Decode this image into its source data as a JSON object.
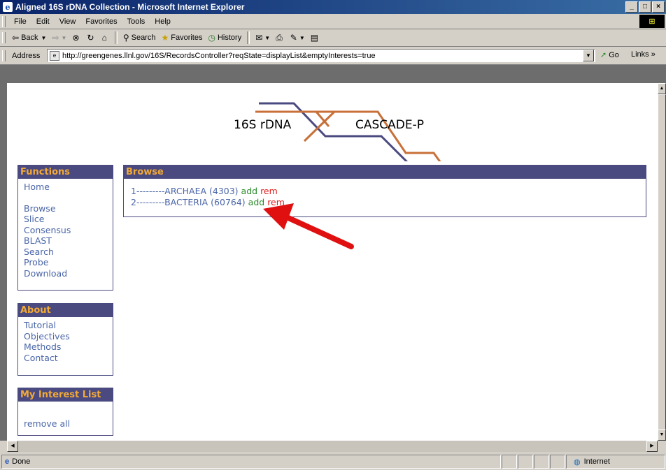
{
  "window": {
    "title": "Aligned 16S rDNA Collection - Microsoft Internet Explorer",
    "min": "_",
    "max": "□",
    "close": "×"
  },
  "menu": [
    "File",
    "Edit",
    "View",
    "Favorites",
    "Tools",
    "Help"
  ],
  "toolbar": {
    "back": "Back",
    "search": "Search",
    "favorites": "Favorites",
    "history": "History"
  },
  "address": {
    "label": "Address",
    "url": "http://greengenes.llnl.gov/16S/RecordsController?reqState=displayList&emptyInterests=true",
    "go": "Go",
    "links": "Links"
  },
  "logo": {
    "left": "16S rDNA",
    "right": "CASCADE-P"
  },
  "functions": {
    "title": "Functions",
    "items": [
      "Home",
      "Browse",
      "Slice",
      "Consensus",
      "BLAST",
      "Search",
      "Probe",
      "Download"
    ]
  },
  "about": {
    "title": "About",
    "items": [
      "Tutorial",
      "Objectives",
      "Methods",
      "Contact"
    ]
  },
  "interest": {
    "title": "My Interest List",
    "remove_all": "remove all"
  },
  "browse": {
    "title": "Browse",
    "rows": [
      {
        "label": "1---------ARCHAEA (4303)",
        "add": "add",
        "rem": "rem"
      },
      {
        "label": "2---------BACTERIA (60764)",
        "add": "add",
        "rem": "rem"
      }
    ]
  },
  "status": {
    "left": "Done",
    "zone": "Internet"
  },
  "colors": {
    "panel_header_bg": "#4a4a80",
    "panel_header_text": "#f3a935",
    "link": "#4a66a8",
    "add": "#2a8a2a",
    "rem": "#e02020",
    "arrow": "#e01010"
  }
}
